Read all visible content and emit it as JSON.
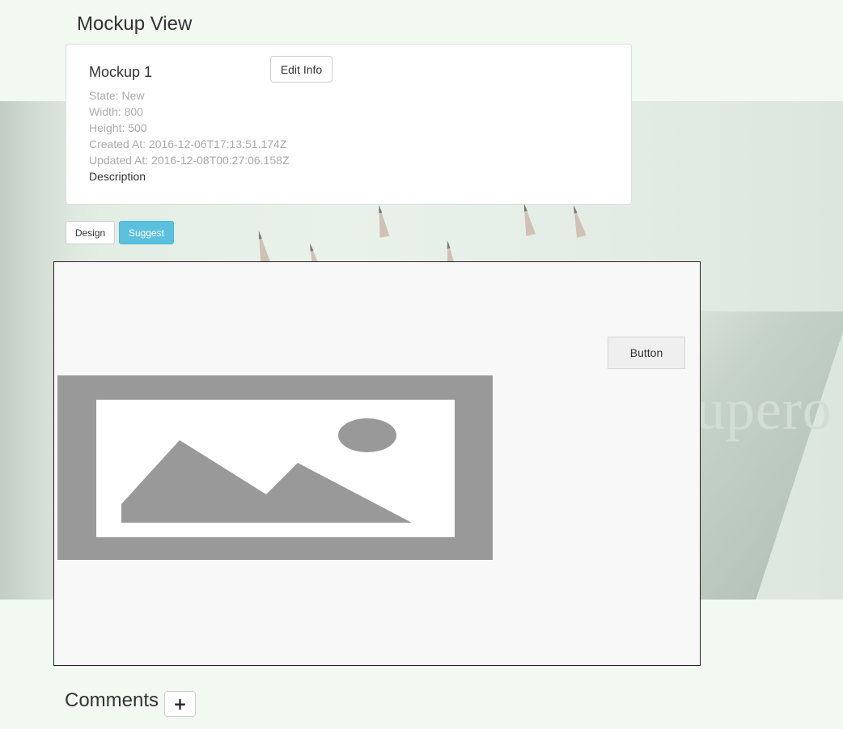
{
  "page": {
    "title": "Mockup View"
  },
  "background": {
    "text": "upero"
  },
  "mockup": {
    "name": "Mockup 1",
    "edit_label": "Edit Info",
    "state": "State: New",
    "width": "Width: 800",
    "height": "Height: 500",
    "created_at": "Created At: 2016-12-06T17:13:51.174Z",
    "updated_at": "Updated At: 2016-12-08T00:27:06.158Z",
    "description_label": "Description"
  },
  "tabs": [
    {
      "label": "Design",
      "active": false
    },
    {
      "label": "Suggest",
      "active": true
    }
  ],
  "canvas": {
    "button_label": "Button",
    "image_icon": "image-placeholder-icon"
  },
  "comments": {
    "title": "Comments",
    "add_label": "+"
  },
  "colors": {
    "page_background": "#f1f9f1",
    "suggest_active": "#5bc0de",
    "placeholder_gray": "#999999"
  }
}
